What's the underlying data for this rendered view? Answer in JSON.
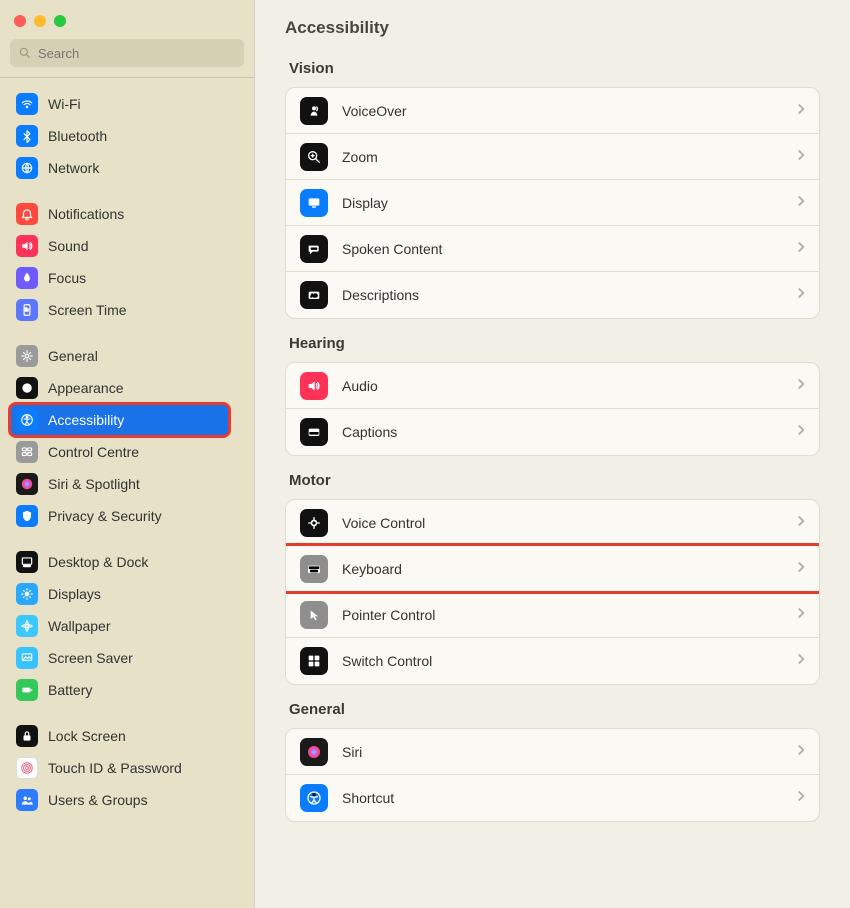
{
  "search": {
    "placeholder": "Search"
  },
  "page_title": "Accessibility",
  "sidebar_groups": [
    {
      "items": [
        {
          "id": "wifi",
          "label": "Wi-Fi",
          "color": "#0a7cff"
        },
        {
          "id": "bluetooth",
          "label": "Bluetooth",
          "color": "#0a7cff"
        },
        {
          "id": "network",
          "label": "Network",
          "color": "#0a7cff"
        }
      ]
    },
    {
      "items": [
        {
          "id": "notifications",
          "label": "Notifications",
          "color": "#ff4a3d"
        },
        {
          "id": "sound",
          "label": "Sound",
          "color": "#ff3358"
        },
        {
          "id": "focus",
          "label": "Focus",
          "color": "#6e5bff"
        },
        {
          "id": "screentime",
          "label": "Screen Time",
          "color": "#5b76ff"
        }
      ]
    },
    {
      "items": [
        {
          "id": "general",
          "label": "General",
          "color": "#9a9a9a"
        },
        {
          "id": "appearance",
          "label": "Appearance",
          "color": "#111"
        },
        {
          "id": "accessibility",
          "label": "Accessibility",
          "color": "#0a7cff",
          "selected": true,
          "highlighted": true
        },
        {
          "id": "controlcentre",
          "label": "Control Centre",
          "color": "#9a9a9a"
        },
        {
          "id": "siri",
          "label": "Siri & Spotlight",
          "color": "#1a1a1a"
        },
        {
          "id": "privacy",
          "label": "Privacy & Security",
          "color": "#0a7cff"
        }
      ]
    },
    {
      "items": [
        {
          "id": "desktop",
          "label": "Desktop & Dock",
          "color": "#111"
        },
        {
          "id": "displays",
          "label": "Displays",
          "color": "#2aa8ff"
        },
        {
          "id": "wallpaper",
          "label": "Wallpaper",
          "color": "#3ac8ff"
        },
        {
          "id": "screensaver",
          "label": "Screen Saver",
          "color": "#36c3ff"
        },
        {
          "id": "battery",
          "label": "Battery",
          "color": "#34c759"
        }
      ]
    },
    {
      "items": [
        {
          "id": "lockscreen",
          "label": "Lock Screen",
          "color": "#111"
        },
        {
          "id": "touchid",
          "label": "Touch ID & Password",
          "color": "#fff"
        },
        {
          "id": "users",
          "label": "Users & Groups",
          "color": "#2e7bff"
        }
      ]
    }
  ],
  "main_sections": [
    {
      "title": "Vision",
      "items": [
        {
          "id": "voiceover",
          "label": "VoiceOver",
          "color": "#111"
        },
        {
          "id": "zoom",
          "label": "Zoom",
          "color": "#111"
        },
        {
          "id": "display",
          "label": "Display",
          "color": "#0a7cff"
        },
        {
          "id": "spoken",
          "label": "Spoken Content",
          "color": "#111"
        },
        {
          "id": "descriptions",
          "label": "Descriptions",
          "color": "#111"
        }
      ]
    },
    {
      "title": "Hearing",
      "items": [
        {
          "id": "audio",
          "label": "Audio",
          "color": "#ff3358"
        },
        {
          "id": "captions",
          "label": "Captions",
          "color": "#111"
        }
      ]
    },
    {
      "title": "Motor",
      "items": [
        {
          "id": "voicecontrol",
          "label": "Voice Control",
          "color": "#111"
        },
        {
          "id": "keyboard",
          "label": "Keyboard",
          "color": "#8e8e8e",
          "highlighted": true
        },
        {
          "id": "pointer",
          "label": "Pointer Control",
          "color": "#8e8e8e"
        },
        {
          "id": "switch",
          "label": "Switch Control",
          "color": "#111"
        }
      ]
    },
    {
      "title": "General",
      "items": [
        {
          "id": "siri-a11y",
          "label": "Siri",
          "color": "#1a1a1a"
        },
        {
          "id": "shortcut",
          "label": "Shortcut",
          "color": "#0a7cff"
        }
      ]
    }
  ]
}
